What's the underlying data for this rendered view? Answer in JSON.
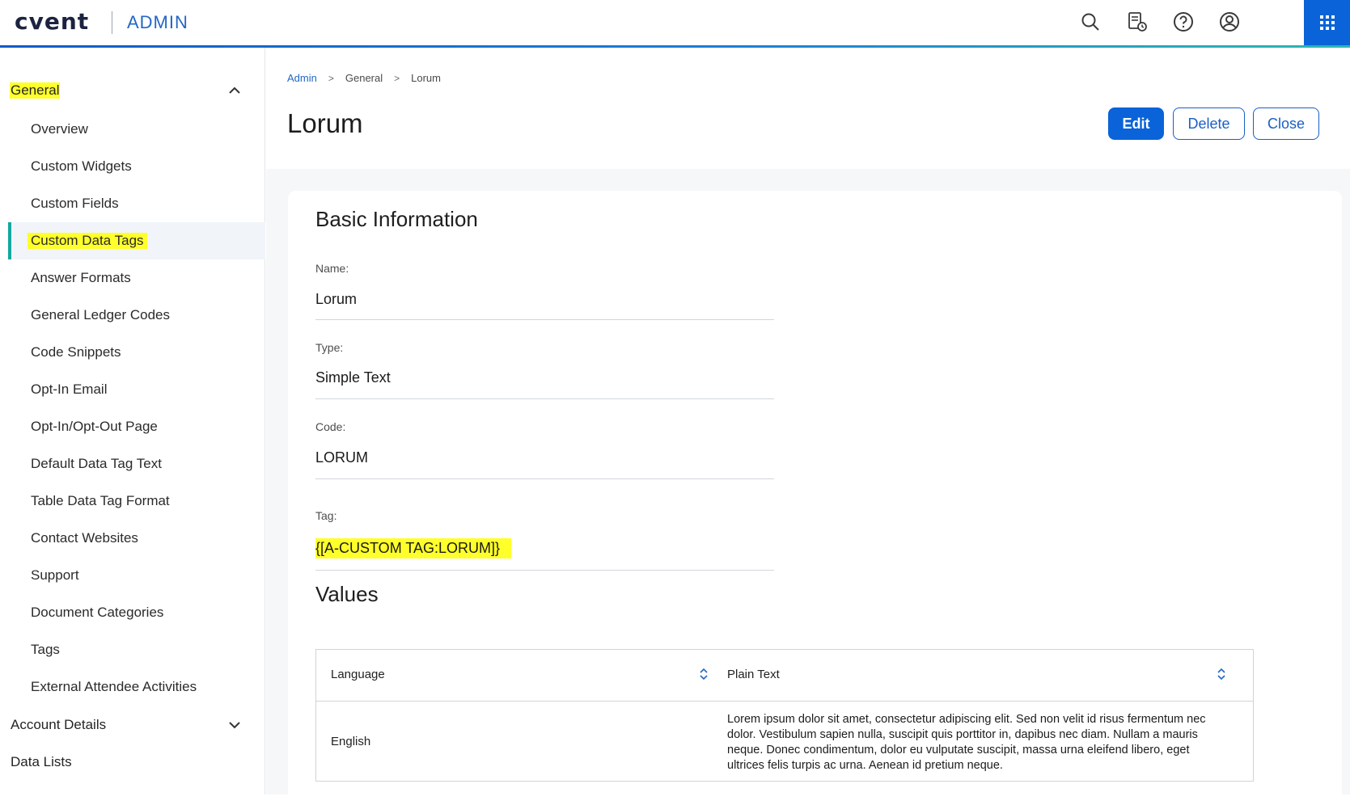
{
  "header": {
    "logo": "cvent",
    "product": "ADMIN",
    "icons": [
      "search-icon",
      "report-schedule-icon",
      "help-icon",
      "account-icon",
      "apps-grid-icon"
    ],
    "accent_color": "#0a63d8"
  },
  "sidebar": {
    "sections": [
      {
        "label": "General",
        "expanded": true,
        "highlighted": true
      },
      {
        "label": "Account Details",
        "expanded": false
      },
      {
        "label": "Data Lists",
        "expanded": false
      }
    ],
    "items": [
      {
        "label": "Overview"
      },
      {
        "label": "Custom Widgets"
      },
      {
        "label": "Custom Fields"
      },
      {
        "label": "Custom Data Tags",
        "active": true,
        "highlighted": true
      },
      {
        "label": "Answer Formats"
      },
      {
        "label": "General Ledger Codes"
      },
      {
        "label": "Code Snippets"
      },
      {
        "label": "Opt-In Email"
      },
      {
        "label": "Opt-In/Opt-Out Page"
      },
      {
        "label": "Default Data Tag Text"
      },
      {
        "label": "Table Data Tag Format"
      },
      {
        "label": "Contact Websites"
      },
      {
        "label": "Support"
      },
      {
        "label": "Document Categories"
      },
      {
        "label": "Tags"
      },
      {
        "label": "External Attendee Activities"
      }
    ]
  },
  "breadcrumb": [
    "Admin",
    "General",
    "Lorum"
  ],
  "page": {
    "title": "Lorum",
    "buttons": {
      "edit": "Edit",
      "delete": "Delete",
      "close": "Close"
    }
  },
  "basic_info": {
    "title": "Basic Information",
    "fields": [
      {
        "label": "Name:",
        "value": "Lorum"
      },
      {
        "label": "Type:",
        "value": "Simple Text"
      },
      {
        "label": "Code:",
        "value": "LORUM"
      },
      {
        "label": "Tag:",
        "value": "{[A-CUSTOM TAG:LORUM]}",
        "highlighted": true
      }
    ]
  },
  "values": {
    "title": "Values",
    "columns": [
      "Language",
      "Plain Text"
    ],
    "rows": [
      {
        "language": "English",
        "plain_text": "Lorem ipsum dolor sit amet, consectetur adipiscing elit. Sed non velit id risus fermentum nec dolor. Vestibulum sapien nulla, suscipit quis porttitor in, dapibus nec diam. Nullam a mauris neque. Donec condimentum, dolor eu vulputate suscipit, massa urna eleifend libero, eget ultrices felis turpis ac urna. Aenean id pretium neque."
      }
    ]
  }
}
